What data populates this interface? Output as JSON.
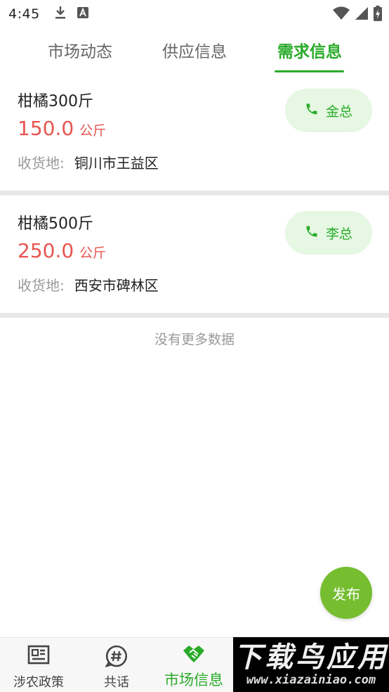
{
  "status_bar": {
    "time": "4:45"
  },
  "tabs": [
    {
      "label": "市场动态",
      "active": false
    },
    {
      "label": "供应信息",
      "active": false
    },
    {
      "label": "需求信息",
      "active": true
    }
  ],
  "listings": [
    {
      "title": "柑橘300斤",
      "price": "150.0",
      "unit": "公斤",
      "address_label": "收货地:",
      "address": "铜川市王益区",
      "contact": "金总"
    },
    {
      "title": "柑橘500斤",
      "price": "250.0",
      "unit": "公斤",
      "address_label": "收货地:",
      "address": "西安市碑林区",
      "contact": "李总"
    }
  ],
  "no_more_text": "没有更多数据",
  "fab_label": "发布",
  "bottom_nav": [
    {
      "label": "涉农政策",
      "icon": "news-icon",
      "active": false
    },
    {
      "label": "共话",
      "icon": "hashtag-chat-icon",
      "active": false
    },
    {
      "label": "市场信息",
      "icon": "handshake-icon",
      "active": true
    }
  ],
  "watermark": {
    "title": "下载鸟应用",
    "url": "www.xiazainiao.com"
  },
  "colors": {
    "accent_green": "#2aab2a",
    "price_red": "#e85550",
    "fab_green": "#76bd30",
    "call_bg": "#e6f7e3"
  }
}
